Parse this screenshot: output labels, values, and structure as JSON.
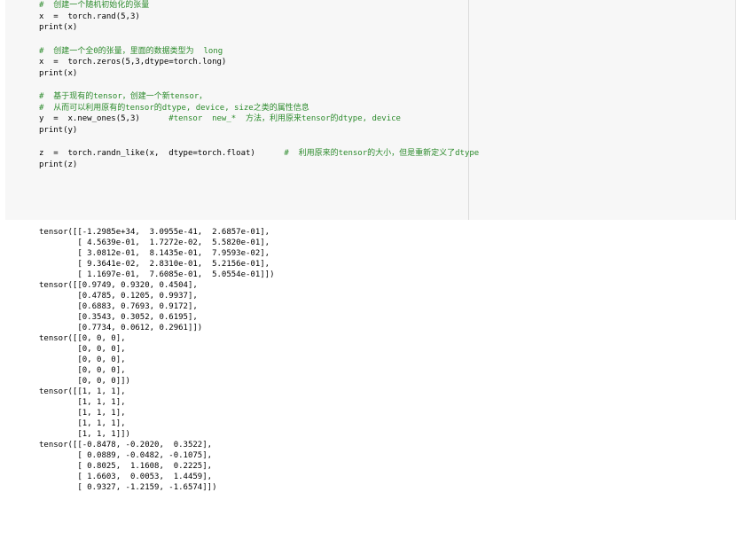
{
  "code_cell": {
    "lines": [
      {
        "type": "comment",
        "text": "#  创建一个随机初始化的张量"
      },
      {
        "type": "code",
        "text": "x  =  torch.rand(5,3)"
      },
      {
        "type": "code",
        "text": "print(x)"
      },
      {
        "type": "blank",
        "text": ""
      },
      {
        "type": "comment",
        "text": "#  创建一个全0的张量，里面的数据类型为  long"
      },
      {
        "type": "code",
        "text": "x  =  torch.zeros(5,3,dtype=torch.long)"
      },
      {
        "type": "code",
        "text": "print(x)"
      },
      {
        "type": "blank",
        "text": ""
      },
      {
        "type": "comment",
        "text": "#  基于现有的tensor，创建一个新tensor，"
      },
      {
        "type": "comment",
        "text": "#  从而可以利用原有的tensor的dtype, device, size之类的属性信息"
      },
      {
        "type": "code_with_comment",
        "text": "y  =  x.new_ones(5,3)",
        "comment": "      #tensor  new_*  方法，利用原来tensor的dtype, device"
      },
      {
        "type": "code",
        "text": "print(y)"
      },
      {
        "type": "blank",
        "text": ""
      },
      {
        "type": "code_with_comment",
        "text": "z  =  torch.randn_like(x,  dtype=torch.float)",
        "comment": "      #  利用原来的tensor的大小，但是重新定义了dtype"
      },
      {
        "type": "code",
        "text": "print(z)"
      }
    ]
  },
  "output": {
    "lines": [
      "tensor([[-1.2985e+34,  3.0955e-41,  2.6857e-01],",
      "        [ 4.5639e-01,  1.7272e-02,  5.5820e-01],",
      "        [ 3.0812e-01,  8.1435e-01,  7.9593e-02],",
      "        [ 9.3641e-02,  2.8310e-01,  5.2156e-01],",
      "        [ 1.1697e-01,  7.6085e-01,  5.0554e-01]])",
      "tensor([[0.9749, 0.9320, 0.4504],",
      "        [0.4785, 0.1205, 0.9937],",
      "        [0.6883, 0.7693, 0.9172],",
      "        [0.3543, 0.3052, 0.6195],",
      "        [0.7734, 0.0612, 0.2961]])",
      "tensor([[0, 0, 0],",
      "        [0, 0, 0],",
      "        [0, 0, 0],",
      "        [0, 0, 0],",
      "        [0, 0, 0]])",
      "tensor([[1, 1, 1],",
      "        [1, 1, 1],",
      "        [1, 1, 1],",
      "        [1, 1, 1],",
      "        [1, 1, 1]])",
      "tensor([[-0.8478, -0.2020,  0.3522],",
      "        [ 0.0889, -0.0482, -0.1075],",
      "        [ 0.8025,  1.1608,  0.2225],",
      "        [ 1.6603,  0.0053,  1.4459],",
      "        [ 0.9327, -1.2159, -1.6574]])"
    ]
  },
  "colors": {
    "comment": "#2b8a2b",
    "cell_background": "#f7f7f7",
    "text": "#000000"
  }
}
